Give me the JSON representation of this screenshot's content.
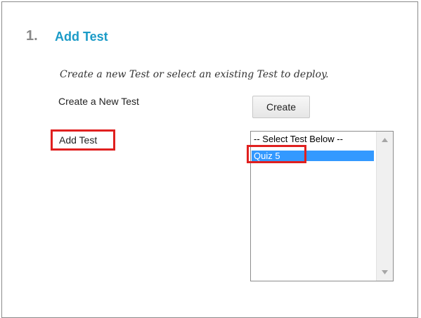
{
  "step": {
    "number": "1.",
    "title": "Add Test"
  },
  "instructions": "Create a new Test or select an existing Test to deploy.",
  "create": {
    "label": "Create a New Test",
    "button_label": "Create"
  },
  "add": {
    "label": "Add Test"
  },
  "test_list": {
    "placeholder_option": "-- Select Test Below --",
    "selected_option": "Quiz 5"
  },
  "icons": {
    "scroll_up": "chevron-up-icon",
    "scroll_down": "chevron-down-icon"
  },
  "colors": {
    "title": "#1b9bc7",
    "step_number": "#888888",
    "highlight": "#e0201f",
    "selection": "#3399ff"
  }
}
